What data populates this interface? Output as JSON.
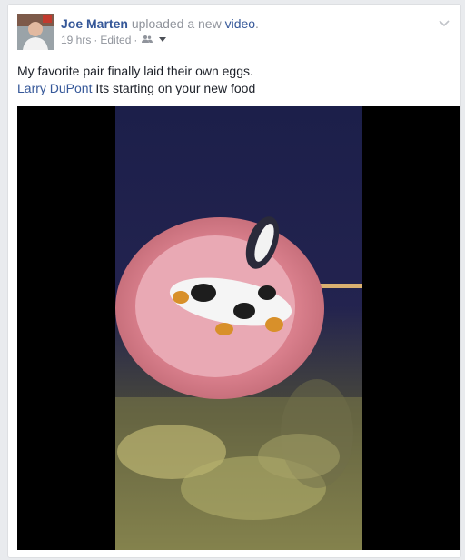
{
  "post": {
    "author": "Joe Marten",
    "action_prefix": "uploaded a new",
    "action_object": "video",
    "action_suffix": ".",
    "time": "19 hrs",
    "separator": "·",
    "edited": "Edited",
    "separator2": "·",
    "audience_icon": "friends-icon",
    "body_line1": "My favorite pair finally laid their own eggs.",
    "mention": "Larry DuPont",
    "body_line2_rest": " Its starting on your new food",
    "menu_icon": "chevron-down-icon"
  },
  "colors": {
    "link": "#365899",
    "meta": "#90949c",
    "text": "#1d2129"
  }
}
